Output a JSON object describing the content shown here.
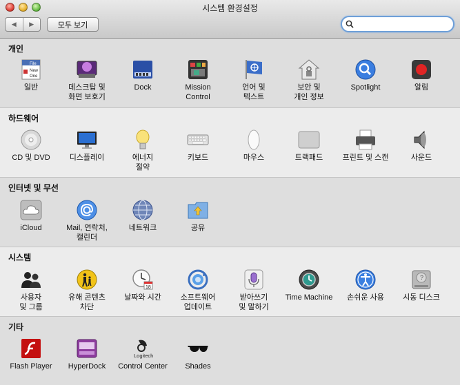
{
  "window": {
    "title": "시스템 환경설정"
  },
  "toolbar": {
    "back_glyph": "◀",
    "forward_glyph": "▶",
    "show_all_label": "모두 보기",
    "search": {
      "value": "",
      "placeholder": ""
    }
  },
  "sections": [
    {
      "title": "개인",
      "items": [
        {
          "label": "일반",
          "icon": "general-icon"
        },
        {
          "label": "데스크탑 및\n화면 보호기",
          "icon": "desktop-screensaver-icon"
        },
        {
          "label": "Dock",
          "icon": "dock-icon"
        },
        {
          "label": "Mission\nControl",
          "icon": "mission-control-icon"
        },
        {
          "label": "언어 및\n텍스트",
          "icon": "language-text-icon"
        },
        {
          "label": "보안 및\n개인 정보",
          "icon": "security-privacy-icon"
        },
        {
          "label": "Spotlight",
          "icon": "spotlight-icon"
        },
        {
          "label": "알림",
          "icon": "notifications-icon"
        }
      ]
    },
    {
      "title": "하드웨어",
      "items": [
        {
          "label": "CD 및 DVD",
          "icon": "cd-dvd-icon"
        },
        {
          "label": "디스플레이",
          "icon": "display-icon"
        },
        {
          "label": "에너지\n절약",
          "icon": "energy-saver-icon"
        },
        {
          "label": "키보드",
          "icon": "keyboard-icon"
        },
        {
          "label": "마우스",
          "icon": "mouse-icon"
        },
        {
          "label": "트랙패드",
          "icon": "trackpad-icon"
        },
        {
          "label": "프린트 및 스캔",
          "icon": "print-scan-icon"
        },
        {
          "label": "사운드",
          "icon": "sound-icon"
        }
      ]
    },
    {
      "title": "인터넷 및 무선",
      "items": [
        {
          "label": "iCloud",
          "icon": "icloud-icon"
        },
        {
          "label": "Mail, 연락처,\n캘린더",
          "icon": "mail-contacts-calendar-icon"
        },
        {
          "label": "네트워크",
          "icon": "network-icon"
        },
        {
          "label": "공유",
          "icon": "sharing-icon"
        }
      ]
    },
    {
      "title": "시스템",
      "items": [
        {
          "label": "사용자\n및 그룹",
          "icon": "users-groups-icon"
        },
        {
          "label": "유해 콘텐츠\n차단",
          "icon": "parental-controls-icon"
        },
        {
          "label": "날짜와 시간",
          "icon": "date-time-icon"
        },
        {
          "label": "소프트웨어\n업데이트",
          "icon": "software-update-icon"
        },
        {
          "label": "받아쓰기\n및 말하기",
          "icon": "dictation-speech-icon"
        },
        {
          "label": "Time Machine",
          "icon": "time-machine-icon"
        },
        {
          "label": "손쉬운 사용",
          "icon": "accessibility-icon"
        },
        {
          "label": "시동 디스크",
          "icon": "startup-disk-icon"
        }
      ]
    },
    {
      "title": "기타",
      "items": [
        {
          "label": "Flash Player",
          "icon": "flash-player-icon"
        },
        {
          "label": "HyperDock",
          "icon": "hyperdock-icon"
        },
        {
          "label": "Control Center",
          "icon": "logitech-control-center-icon",
          "logo_text": "Logitech"
        },
        {
          "label": "Shades",
          "icon": "shades-icon"
        }
      ]
    }
  ],
  "icon_texts": {
    "general": [
      "File",
      "New",
      "One"
    ],
    "date_badge": "18"
  }
}
